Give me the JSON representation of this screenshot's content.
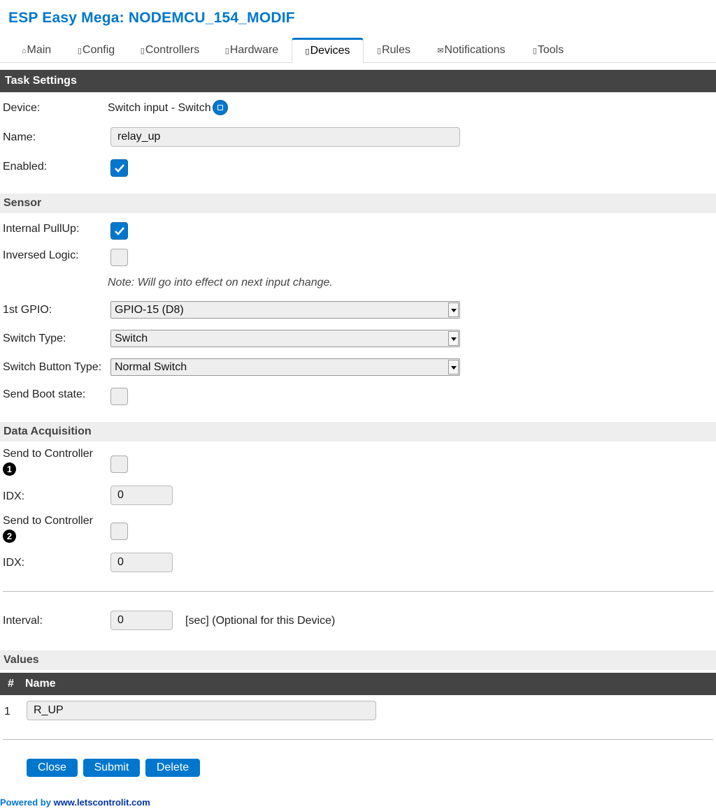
{
  "app_title": "ESP Easy Mega: NODEMCU_154_MODIF",
  "tabs": [
    {
      "glyph": "⌂",
      "label": "Main"
    },
    {
      "glyph": "▯",
      "label": "Config"
    },
    {
      "glyph": "▯",
      "label": "Controllers"
    },
    {
      "glyph": "▯",
      "label": "Hardware"
    },
    {
      "glyph": "▯",
      "label": "Devices"
    },
    {
      "glyph": "▯",
      "label": "Rules"
    },
    {
      "glyph": "✉",
      "label": "Notifications"
    },
    {
      "glyph": "▯",
      "label": "Tools"
    }
  ],
  "active_tab": "Devices",
  "task_settings": {
    "header": "Task Settings",
    "device_label": "Device:",
    "device_value": "Switch input - Switch",
    "name_label": "Name:",
    "name_value": "relay_up",
    "enabled_label": "Enabled:",
    "enabled": true
  },
  "sensor": {
    "header": "Sensor",
    "internal_pullup_label": "Internal PullUp:",
    "internal_pullup": true,
    "inversed_logic_label": "Inversed Logic:",
    "inversed_logic": false,
    "note": "Note: Will go into effect on next input change.",
    "gpio_label": "1st GPIO:",
    "gpio_value": "GPIO-15 (D8)",
    "switch_type_label": "Switch Type:",
    "switch_type_value": "Switch",
    "switch_button_type_label": "Switch Button Type:",
    "switch_button_type_value": "Normal Switch",
    "send_boot_state_label": "Send Boot state:",
    "send_boot_state": false
  },
  "data_acquisition": {
    "header": "Data Acquisition",
    "controllers": [
      {
        "label": "Send to Controller",
        "number": "1",
        "checked": false,
        "idx_label": "IDX:",
        "idx_value": "0"
      },
      {
        "label": "Send to Controller",
        "number": "2",
        "checked": false,
        "idx_label": "IDX:",
        "idx_value": "0"
      }
    ],
    "interval_label": "Interval:",
    "interval_value": "0",
    "interval_hint": "[sec] (Optional for this Device)"
  },
  "values": {
    "header": "Values",
    "col_num": "#",
    "col_name": "Name",
    "rows": [
      {
        "num": "1",
        "name": "R_UP"
      }
    ]
  },
  "buttons": {
    "close": "Close",
    "submit": "Submit",
    "delete": "Delete"
  },
  "footer": {
    "prefix": "Powered by ",
    "link": "www.letscontrolit.com"
  },
  "colors": {
    "accent": "#0077cc",
    "header_dark": "#444444",
    "section_bg": "#eeeeee"
  }
}
